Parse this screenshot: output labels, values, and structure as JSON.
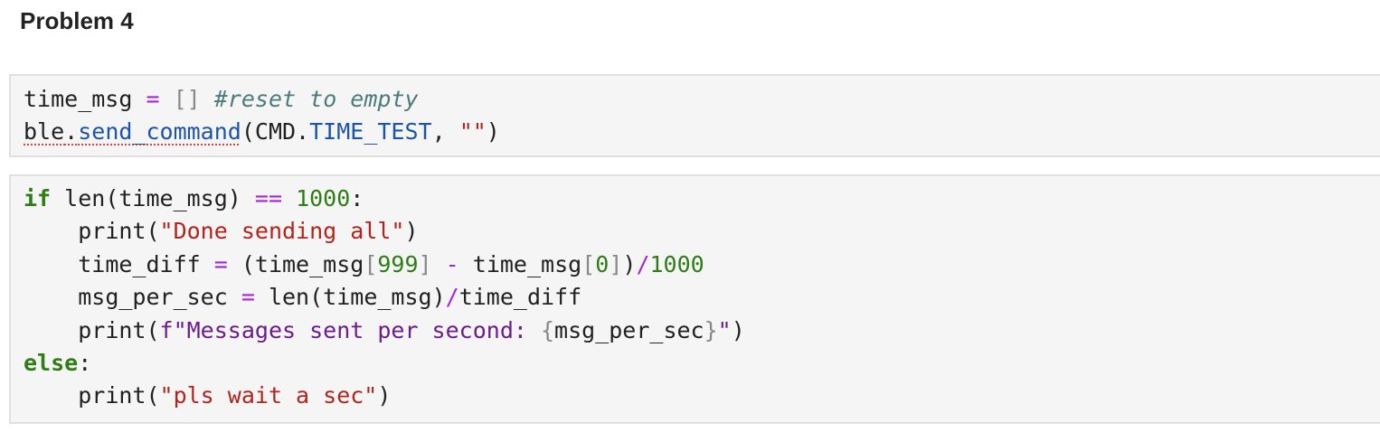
{
  "heading": "Problem 4",
  "cell1": {
    "l1": {
      "var": "time_msg",
      "eq": "=",
      "brackets": "[]",
      "comment": "#reset to empty"
    },
    "l2": {
      "obj": "ble",
      "dot": ".",
      "method": "send_command",
      "open": "(CMD.",
      "attr": "TIME_TEST",
      "comma": ", ",
      "str": "\"\"",
      "close": ")"
    }
  },
  "cell2": {
    "l1": {
      "kw": "if",
      "a": " len(time_msg) ",
      "op": "==",
      "sp": " ",
      "num": "1000",
      "colon": ":"
    },
    "l2": {
      "indent": "    ",
      "a": "print(",
      "str": "\"Done sending all\"",
      "b": ")"
    },
    "l3": {
      "indent": "    ",
      "a": "time_diff ",
      "eq": "=",
      "b": " (time_msg",
      "lb1": "[",
      "n1": "999",
      "rb1": "]",
      "sp1": " ",
      "minus": "-",
      "c": " time_msg",
      "lb2": "[",
      "n2": "0",
      "rb2": "]",
      "d": ")",
      "div": "/",
      "n3": "1000"
    },
    "l4": {
      "indent": "    ",
      "a": "msg_per_sec ",
      "eq": "=",
      "b": " len(time_msg)",
      "div": "/",
      "c": "time_diff"
    },
    "l5": {
      "indent": "    ",
      "a": "print(",
      "f": "f\"Messages sent per second: ",
      "lbr": "{",
      "var": "msg_per_sec",
      "rbr": "}",
      "q": "\"",
      "b": ")"
    },
    "l6": {
      "kw": "else",
      "colon": ":"
    },
    "l7": {
      "indent": "    ",
      "a": "print(",
      "str": "\"pls wait a sec\"",
      "b": ")"
    }
  },
  "colors": {
    "keyword": "#2e7d16",
    "operator": "#a626d8",
    "number": "#2e7d16",
    "string": "#b3241c",
    "fstring": "#6c1d8a",
    "comment": "#4b7c7a",
    "attribute": "#1c55a8",
    "cell_background": "#f5f5f5",
    "cell_border": "#e0e0e0"
  }
}
